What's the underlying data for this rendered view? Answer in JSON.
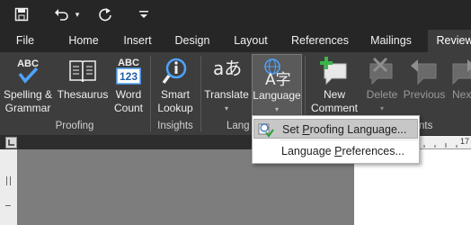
{
  "colors": {
    "ribbon": "#3d3d3d",
    "titlebar": "#262626",
    "menu_highlight": "#c7c7c7"
  },
  "qat": {
    "save_icon": "save-icon",
    "undo_icon": "undo-icon",
    "undo_caret": "▾",
    "redo_icon": "redo-icon",
    "customize_icon": "customize-qat-icon"
  },
  "tabs": [
    {
      "label": "File"
    },
    {
      "label": "Home"
    },
    {
      "label": "Insert"
    },
    {
      "label": "Design"
    },
    {
      "label": "Layout"
    },
    {
      "label": "References"
    },
    {
      "label": "Mailings"
    },
    {
      "label": "Review",
      "active": true
    }
  ],
  "ribbon": {
    "spelling": {
      "line1": "Spelling &",
      "line2": "Grammar",
      "icon_text": "ABC"
    },
    "thesaurus": {
      "line1": "Thesaurus"
    },
    "wordcount": {
      "line1": "Word",
      "line2": "Count",
      "icon_top": "ABC",
      "icon_bottom": "123"
    },
    "proofing_label": "Proofing",
    "smartlookup": {
      "line1": "Smart",
      "line2": "Lookup"
    },
    "insights_label": "Insights",
    "translate": {
      "line1": "Translate",
      "icon_text": "aあ"
    },
    "language": {
      "line1": "Language",
      "icon_text": "A字"
    },
    "language_group_label": "Lang",
    "newcomment": {
      "line1": "New",
      "line2": "Comment"
    },
    "delete": {
      "line1": "Delete"
    },
    "previous": {
      "line1": "Previous"
    },
    "next": {
      "line1": "Nex"
    },
    "comments_label": "ments",
    "caret": "▾"
  },
  "ruler": {
    "marker": "17"
  },
  "menu": {
    "items": [
      {
        "label_pre": "Set ",
        "label_acc": "P",
        "label_post": "roofing Language...",
        "highlighted": true
      },
      {
        "label_pre": "Language ",
        "label_acc": "P",
        "label_post": "references..."
      }
    ]
  }
}
